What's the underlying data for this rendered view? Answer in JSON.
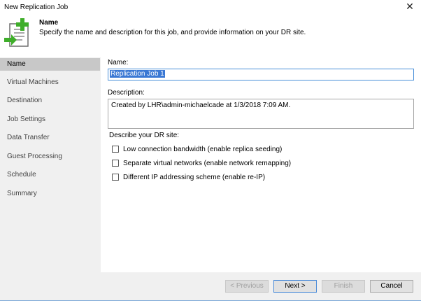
{
  "window": {
    "title": "New Replication Job",
    "close": "✕"
  },
  "header": {
    "title": "Name",
    "description": "Specify the name and description for this job, and provide information on your DR site."
  },
  "nav": {
    "items": [
      {
        "label": "Name"
      },
      {
        "label": "Virtual Machines"
      },
      {
        "label": "Destination"
      },
      {
        "label": "Job Settings"
      },
      {
        "label": "Data Transfer"
      },
      {
        "label": "Guest Processing"
      },
      {
        "label": "Schedule"
      },
      {
        "label": "Summary"
      }
    ],
    "selected": "Name"
  },
  "form": {
    "name_label": "Name:",
    "name_value": "Replication Job 1",
    "description_label": "Description:",
    "description_value": "Created by LHR\\admin-michaelcade at 1/3/2018 7:09 AM.",
    "dr_label": "Describe your DR site:",
    "options": [
      {
        "label": "Low connection bandwidth (enable replica seeding)",
        "checked": false
      },
      {
        "label": "Separate virtual networks (enable network remapping)",
        "checked": false
      },
      {
        "label": "Different IP addressing scheme (enable re-IP)",
        "checked": false
      }
    ]
  },
  "footer": {
    "previous": "< Previous",
    "next": "Next >",
    "finish": "Finish",
    "cancel": "Cancel"
  },
  "colors": {
    "accent": "#3a78d4",
    "green_plus": "#3fae2a"
  }
}
